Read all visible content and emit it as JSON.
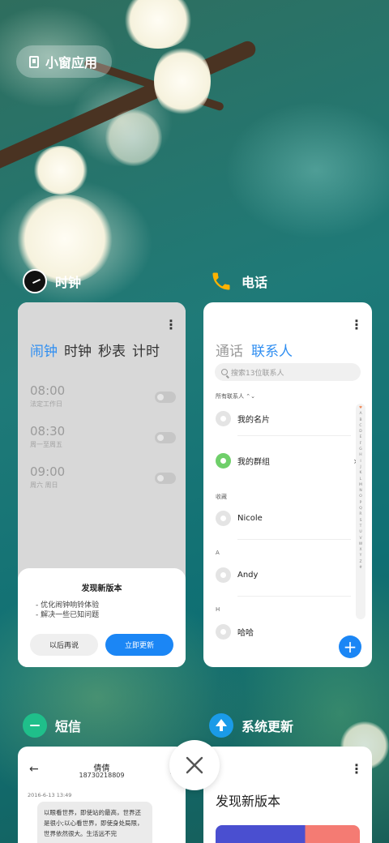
{
  "small_window": {
    "label": "小窗应用",
    "icon": "small-window-icon"
  },
  "apps": {
    "clock": {
      "name": "时钟",
      "icon": "clock-icon",
      "tabs": [
        "闹钟",
        "时钟",
        "秒表",
        "计时"
      ],
      "active_tab": 0,
      "alarms": [
        {
          "time": "08:00",
          "desc": "法定工作日",
          "enabled": false
        },
        {
          "time": "08:30",
          "desc": "周一至周五",
          "enabled": false
        },
        {
          "time": "09:00",
          "desc": "周六 周日",
          "enabled": false
        }
      ],
      "dialog": {
        "title": "发现新版本",
        "lines": [
          "- 优化闹钟响铃体验",
          "- 解决一些已知问题"
        ],
        "later_label": "以后再说",
        "update_label": "立即更新"
      }
    },
    "phone": {
      "name": "电话",
      "icon": "phone-icon",
      "tabs": [
        "通话",
        "联系人"
      ],
      "active_tab": 1,
      "search_placeholder": "搜索13位联系人",
      "all_contacts": "所有联系人 ⌃⌄",
      "my_card": "我的名片",
      "my_groups": "我的群组",
      "favorites_label": "收藏",
      "contacts": [
        {
          "section": "",
          "name": "Nicole"
        },
        {
          "section": "A",
          "name": "Andy"
        },
        {
          "section": "H",
          "name": "哈哈"
        }
      ],
      "alphabet": [
        "♥",
        "A",
        "B",
        "C",
        "D",
        "E",
        "F",
        "G",
        "H",
        "I",
        "J",
        "K",
        "L",
        "M",
        "N",
        "O",
        "P",
        "Q",
        "R",
        "S",
        "T",
        "U",
        "V",
        "W",
        "X",
        "Y",
        "Z",
        "#"
      ],
      "add_label": "+"
    },
    "sms": {
      "name": "短信",
      "icon": "message-icon",
      "contact_name": "倩倩",
      "contact_number": "18730218809",
      "date": "2016-6-13 13:49",
      "message": "以眼看世界，即使站的最高，世界还是很小;以心看世界，即使身处局限，世界依然很大。生活远不完"
    },
    "update": {
      "name": "系统更新",
      "icon": "system-update-icon",
      "title": "发现新版本",
      "banner_colors": [
        "#4a4fd0",
        "#f47b73"
      ]
    }
  },
  "close_icon": "close-icon",
  "colors": {
    "accent": "#2f8ef1",
    "primary_button": "#1b86f5"
  }
}
